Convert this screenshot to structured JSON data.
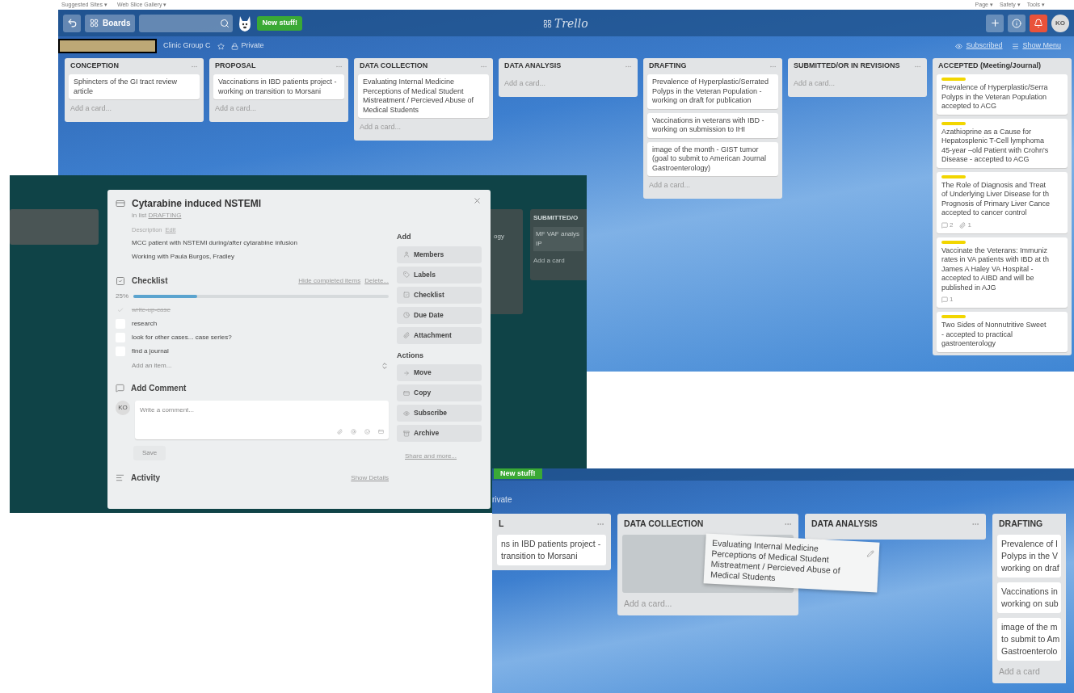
{
  "browser_bar": {
    "left_items": [
      "Suggested Sites ▾",
      "Web Slice Gallery ▾"
    ],
    "right_items": [
      "Page ▾",
      "Safety ▾",
      "Tools ▾"
    ]
  },
  "board": {
    "header": {
      "boards": "Boards",
      "new_stuff": "New stuff!",
      "logo": "Trello",
      "avatar": "KO"
    },
    "board_bar": {
      "team": "Clinic Group C",
      "visibility": "Private",
      "subscribed": "Subscribed",
      "show_menu": "Show Menu"
    },
    "lists": [
      {
        "title": "CONCEPTION",
        "cards": [
          {
            "text": "Sphincters of the GI tract review article"
          }
        ],
        "add_card": "Add a card..."
      },
      {
        "title": "PROPOSAL",
        "cards": [
          {
            "text": "Vaccinations in IBD patients project - working on transition to Morsani"
          }
        ],
        "add_card": "Add a card..."
      },
      {
        "title": "DATA COLLECTION",
        "cards": [
          {
            "text": "Evaluating Internal Medicine Perceptions of Medical Student Mistreatment / Percieved Abuse of Medical Students"
          }
        ],
        "add_card": "Add a card..."
      },
      {
        "title": "DATA ANALYSIS",
        "add_card": "Add a card..."
      },
      {
        "title": "DRAFTING",
        "cards": [
          {
            "text": "Prevalence of Hyperplastic/Serrated Polyps in the Veteran Population - working on draft for publication"
          },
          {
            "text": "Vaccinations in veterans with IBD - working on submission to IHI"
          },
          {
            "text": "image of the month - GIST tumor (goal to submit to American Journal Gastroenterology)"
          }
        ],
        "add_card": "Add a card..."
      },
      {
        "title": "SUBMITTED/OR IN REVISIONS",
        "add_card": "Add a card..."
      },
      {
        "title": "ACCEPTED (Meeting/Journal)",
        "cards": [
          {
            "lines": [
              "Prevalence of Hyperplastic/Serra",
              "Polyps in the Veteran Population",
              "accepted to ACG"
            ],
            "color": "#f2d600"
          },
          {
            "lines": [
              "Azathioprine as a Cause for",
              "Hepatosplenic T-Cell lymphoma",
              "45-year –old Patient with Crohn's",
              "Disease - accepted to ACG"
            ],
            "color": "#f2d600"
          },
          {
            "lines": [
              "The Role of Diagnosis and Treat",
              "of Underlying Liver Disease for th",
              "Prognosis of Primary Liver Cance",
              "accepted to cancer control"
            ],
            "color": "#f2d600",
            "comments": "2",
            "attachments": "1"
          },
          {
            "lines": [
              "Vaccinate the Veterans: Immuniz",
              "rates in VA patients with IBD at th",
              "James A Haley VA Hospital -",
              "accepted to AIBD and will be",
              "published in AJG"
            ],
            "color": "#f2d600",
            "comments": "1"
          },
          {
            "lines": [
              "Two Sides of Nonnutritive Sweet",
              "- accepted to practical",
              "gastroenterology"
            ],
            "color": "#f2d600"
          }
        ]
      }
    ]
  },
  "modal_backdrop": {
    "lists": [
      {
        "lines": [
          "ogy"
        ]
      },
      {
        "title": "SUBMITTED/O",
        "lines": [
          "MF VAF analys",
          "IP"
        ],
        "add_card": "Add a card"
      }
    ]
  },
  "card_modal": {
    "title": "Cytarabine induced NSTEMI",
    "in_list": "in list",
    "list_name": "DRAFTING",
    "description_label": "Description",
    "edit": "Edit",
    "description": [
      "MCC patient with NSTEMI during/after cytarabine infusion",
      "Working with Paula Burgos, Fradley"
    ],
    "checklist": {
      "title": "Checklist",
      "hide_completed": "Hide completed items",
      "delete": "Delete...",
      "percent": "25%",
      "level": 0.25,
      "items": [
        {
          "text": "write-up-case",
          "checked": true
        },
        {
          "text": "research",
          "checked": false
        },
        {
          "text": "look for other cases... case series?",
          "checked": false
        },
        {
          "text": "find a journal",
          "checked": false
        }
      ],
      "add_item": "Add an item..."
    },
    "comment": {
      "title": "Add Comment",
      "avatar": "KO",
      "placeholder": "Write a comment...",
      "save": "Save"
    },
    "activity": {
      "title": "Activity",
      "show_details": "Show Details"
    },
    "add": {
      "title": "Add",
      "buttons": [
        "Members",
        "Labels",
        "Checklist",
        "Due Date",
        "Attachment"
      ]
    },
    "actions": {
      "title": "Actions",
      "buttons": [
        "Move",
        "Copy",
        "Subscribe",
        "Archive"
      ]
    },
    "share": "Share and more..."
  },
  "drag_view": {
    "new_stuff": "New stuff!",
    "visibility": "rivate",
    "lists": [
      {
        "title": "L",
        "cards": [
          {
            "lines": [
              "ns in IBD patients project -",
              "transition to Morsani"
            ]
          }
        ]
      },
      {
        "title": "DATA COLLECTION",
        "drop_placeholder": true,
        "add_card": "Add a card..."
      },
      {
        "title": "DATA ANALYSIS"
      },
      {
        "title": "DRAFTING",
        "cards": [
          {
            "lines": [
              "Prevalence of I",
              "Polyps in the V",
              "working on draf"
            ]
          },
          {
            "lines": [
              "Vaccinations in",
              "working on sub"
            ]
          },
          {
            "lines": [
              "image of the m",
              "to submit to Am",
              "Gastroenterolo"
            ]
          }
        ],
        "add_card": "Add a card"
      }
    ],
    "dragged_card": {
      "lines": [
        "Evaluating Internal Medicine",
        "Perceptions of Medical Student",
        "Mistreatment / Percieved Abuse of",
        "Medical Students"
      ]
    }
  }
}
